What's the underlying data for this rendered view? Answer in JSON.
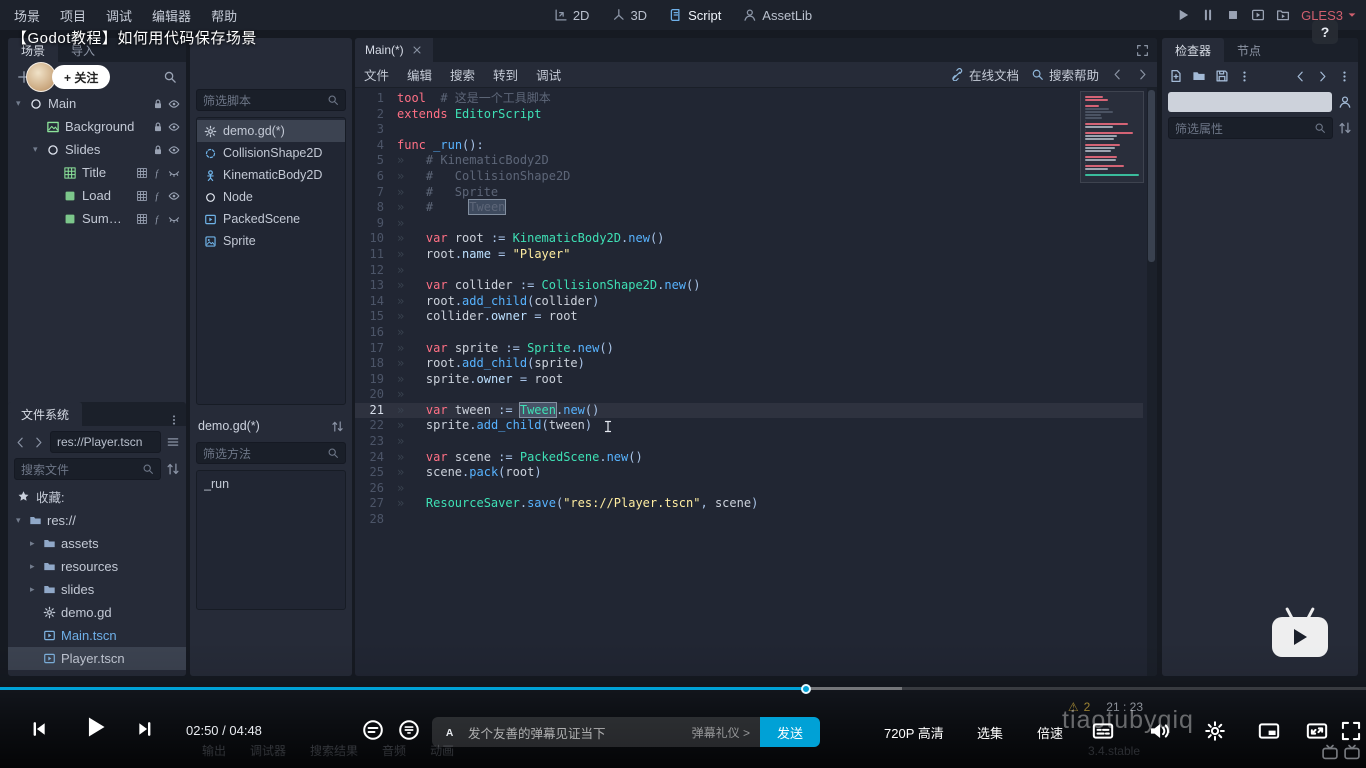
{
  "overlay": {
    "title": "【Godot教程】如何用代码保存场景",
    "follow": "+ 关注",
    "help": "?",
    "watermark": "tiaotubyqiq"
  },
  "menubar": {
    "items": [
      "场景",
      "项目",
      "调试",
      "编辑器",
      "帮助"
    ],
    "workspaces": [
      {
        "label": "2D",
        "icon": "ws2d"
      },
      {
        "label": "3D",
        "icon": "ws3d"
      },
      {
        "label": "Script",
        "icon": "wsscript",
        "active": true
      },
      {
        "label": "AssetLib",
        "icon": "person"
      }
    ],
    "playback": [
      "play",
      "pause",
      "stopsq",
      "playscene",
      "playcustom"
    ],
    "renderer": "GLES3"
  },
  "left_dock": {
    "tabs": [
      {
        "label": "场景",
        "active": true
      },
      {
        "label": "导入"
      }
    ],
    "scene_tree": [
      {
        "label": "Main",
        "depth": 0,
        "expand": true,
        "icon": "nodecirc",
        "color": "#dfe4ee",
        "buttons": [
          "lock",
          "eye"
        ]
      },
      {
        "label": "Background",
        "depth": 1,
        "icon": "texture",
        "color": "#8ce39a",
        "buttons": [
          "lock",
          "eye"
        ]
      },
      {
        "label": "Slides",
        "depth": 1,
        "expand": true,
        "icon": "nodecirc",
        "color": "#dfe4ee",
        "buttons": [
          "lock",
          "eye"
        ]
      },
      {
        "label": "Title",
        "depth": 2,
        "icon": "grid",
        "color": "#8ce39a",
        "buttons": [
          "grid",
          "fscript",
          "eyeclosed"
        ]
      },
      {
        "label": "Load",
        "depth": 2,
        "icon": "controlsq",
        "color": "#8ce39a",
        "buttons": [
          "grid",
          "fscript",
          "eye"
        ]
      },
      {
        "label": "Summary",
        "depth": 2,
        "icon": "controlsq",
        "color": "#8ce39a",
        "buttons": [
          "grid",
          "fscript",
          "eyeclosed"
        ]
      }
    ],
    "filesystem": {
      "title": "文件系统",
      "path": "res://Player.tscn",
      "search_placeholder": "搜索文件",
      "favorites_label": "收藏:",
      "tree": [
        {
          "label": "res://",
          "icon": "folder",
          "color": "#90a8c8",
          "twisty": "▾",
          "depth": 0
        },
        {
          "label": "assets",
          "icon": "folder",
          "color": "#90a8c8",
          "twisty": "▸",
          "depth": 1
        },
        {
          "label": "resources",
          "icon": "folder",
          "color": "#90a8c8",
          "twisty": "▸",
          "depth": 1
        },
        {
          "label": "slides",
          "icon": "folder",
          "color": "#90a8c8",
          "twisty": "▸",
          "depth": 1
        },
        {
          "label": "demo.gd",
          "icon": "gear",
          "color": "#c3cbd8",
          "depth": 1
        },
        {
          "label": "Main.tscn",
          "icon": "scenefilm",
          "color": "#7fb3e0",
          "depth": 1,
          "accent": true
        },
        {
          "label": "Player.tscn",
          "icon": "scenefilm",
          "color": "#7fb3e0",
          "depth": 1,
          "selected": true
        }
      ]
    }
  },
  "script_panel": {
    "filter_scripts_placeholder": "筛选脚本",
    "scripts": [
      {
        "label": "demo.gd(*)",
        "icon": "gear",
        "color": "#c3cbd8",
        "selected": true
      },
      {
        "label": "CollisionShape2D",
        "icon": "shape",
        "color": "#6fb3e8"
      },
      {
        "label": "KinematicBody2D",
        "icon": "body",
        "color": "#6fb3e8"
      },
      {
        "label": "Node",
        "icon": "nodecirc",
        "color": "#e2e7f0"
      },
      {
        "label": "PackedScene",
        "icon": "scenefilm",
        "color": "#6fb3e8"
      },
      {
        "label": "Sprite",
        "icon": "sprite",
        "color": "#6fb3e8"
      }
    ],
    "current_script": "demo.gd(*)",
    "filter_methods_placeholder": "筛选方法",
    "methods": [
      "_run"
    ]
  },
  "editor": {
    "scene_tab": "Main(*)",
    "menus": [
      "文件",
      "编辑",
      "搜索",
      "转到",
      "调试"
    ],
    "online_docs": "在线文档",
    "search_help": "搜索帮助",
    "warning_count": "2",
    "cursor_pos": "21 : 23",
    "current_line": 21,
    "lines": [
      [
        [
          "k",
          "tool"
        ],
        [
          "tx",
          "  "
        ],
        [
          "com",
          "# 这是一个工具脚本"
        ]
      ],
      [
        [
          "k",
          "extends"
        ],
        [
          "tx",
          " "
        ],
        [
          "ty",
          "EditorScript"
        ]
      ],
      [],
      [
        [
          "k",
          "func"
        ],
        [
          "tx",
          " "
        ],
        [
          "fn",
          "_run"
        ],
        [
          "sym",
          "():"
        ]
      ],
      [
        [
          "ws",
          "»   "
        ],
        [
          "com",
          "# KinematicBody2D"
        ]
      ],
      [
        [
          "ws",
          "»   "
        ],
        [
          "com",
          "#   CollisionShape2D"
        ]
      ],
      [
        [
          "ws",
          "»   "
        ],
        [
          "com",
          "#   Sprite"
        ]
      ],
      [
        [
          "ws",
          "»   "
        ],
        [
          "com",
          "#     "
        ],
        [
          "hlcom",
          "Tween"
        ]
      ],
      [
        [
          "ws",
          "»"
        ]
      ],
      [
        [
          "ws",
          "»   "
        ],
        [
          "k",
          "var"
        ],
        [
          "tx",
          " root "
        ],
        [
          "sym",
          ":= "
        ],
        [
          "ty",
          "KinematicBody2D"
        ],
        [
          "sym",
          "."
        ],
        [
          "fn",
          "new"
        ],
        [
          "sym",
          "()"
        ]
      ],
      [
        [
          "ws",
          "»   "
        ],
        [
          "tx",
          "root"
        ],
        [
          "sym",
          "."
        ],
        [
          "mem",
          "name"
        ],
        [
          "sym",
          " = "
        ],
        [
          "str",
          "\"Player\""
        ]
      ],
      [
        [
          "ws",
          "»"
        ]
      ],
      [
        [
          "ws",
          "»   "
        ],
        [
          "k",
          "var"
        ],
        [
          "tx",
          " collider "
        ],
        [
          "sym",
          ":= "
        ],
        [
          "ty",
          "CollisionShape2D"
        ],
        [
          "sym",
          "."
        ],
        [
          "fn",
          "new"
        ],
        [
          "sym",
          "()"
        ]
      ],
      [
        [
          "ws",
          "»   "
        ],
        [
          "tx",
          "root"
        ],
        [
          "sym",
          "."
        ],
        [
          "fn",
          "add_child"
        ],
        [
          "sym",
          "("
        ],
        [
          "tx",
          "collider"
        ],
        [
          "sym",
          ")"
        ]
      ],
      [
        [
          "ws",
          "»   "
        ],
        [
          "tx",
          "collider"
        ],
        [
          "sym",
          "."
        ],
        [
          "mem",
          "owner"
        ],
        [
          "sym",
          " = "
        ],
        [
          "tx",
          "root"
        ]
      ],
      [
        [
          "ws",
          "»"
        ]
      ],
      [
        [
          "ws",
          "»   "
        ],
        [
          "k",
          "var"
        ],
        [
          "tx",
          " sprite "
        ],
        [
          "sym",
          ":= "
        ],
        [
          "ty",
          "Sprite"
        ],
        [
          "sym",
          "."
        ],
        [
          "fn",
          "new"
        ],
        [
          "sym",
          "()"
        ]
      ],
      [
        [
          "ws",
          "»   "
        ],
        [
          "tx",
          "root"
        ],
        [
          "sym",
          "."
        ],
        [
          "fn",
          "add_child"
        ],
        [
          "sym",
          "("
        ],
        [
          "tx",
          "sprite"
        ],
        [
          "sym",
          ")"
        ]
      ],
      [
        [
          "ws",
          "»   "
        ],
        [
          "tx",
          "sprite"
        ],
        [
          "sym",
          "."
        ],
        [
          "mem",
          "owner"
        ],
        [
          "sym",
          " = "
        ],
        [
          "tx",
          "root"
        ]
      ],
      [
        [
          "ws",
          "»"
        ]
      ],
      [
        [
          "ws",
          "»   "
        ],
        [
          "k",
          "var"
        ],
        [
          "tx",
          " tween "
        ],
        [
          "sym",
          ":= "
        ],
        [
          "hlty",
          "Tween"
        ],
        [
          "sym",
          "."
        ],
        [
          "fn",
          "new"
        ],
        [
          "sym",
          "()"
        ]
      ],
      [
        [
          "ws",
          "»   "
        ],
        [
          "tx",
          "sprite"
        ],
        [
          "sym",
          "."
        ],
        [
          "fn",
          "add_child"
        ],
        [
          "sym",
          "("
        ],
        [
          "tx",
          "tween"
        ],
        [
          "sym",
          ")"
        ]
      ],
      [
        [
          "ws",
          "»"
        ]
      ],
      [
        [
          "ws",
          "»   "
        ],
        [
          "k",
          "var"
        ],
        [
          "tx",
          " scene "
        ],
        [
          "sym",
          ":= "
        ],
        [
          "ty",
          "PackedScene"
        ],
        [
          "sym",
          "."
        ],
        [
          "fn",
          "new"
        ],
        [
          "sym",
          "()"
        ]
      ],
      [
        [
          "ws",
          "»   "
        ],
        [
          "tx",
          "scene"
        ],
        [
          "sym",
          "."
        ],
        [
          "fn",
          "pack"
        ],
        [
          "sym",
          "("
        ],
        [
          "tx",
          "root"
        ],
        [
          "sym",
          ")"
        ]
      ],
      [
        [
          "ws",
          "»"
        ]
      ],
      [
        [
          "ws",
          "»   "
        ],
        [
          "ty",
          "ResourceSaver"
        ],
        [
          "sym",
          "."
        ],
        [
          "fn",
          "save"
        ],
        [
          "sym",
          "("
        ],
        [
          "str",
          "\"res://Player.tscn\""
        ],
        [
          "sym",
          ", "
        ],
        [
          "tx",
          "scene"
        ],
        [
          "sym",
          ")"
        ]
      ],
      []
    ]
  },
  "inspector": {
    "tabs": [
      {
        "label": "检查器",
        "active": true
      },
      {
        "label": "节点"
      }
    ],
    "filter_placeholder": "筛选属性"
  },
  "bottom": {
    "panels": [
      "输出",
      "调试器",
      "搜索结果",
      "音频",
      "动画"
    ],
    "version": "3.4.stable"
  },
  "player": {
    "time": "02:50 / 04:48",
    "progress_pct": 59,
    "buffer_pct": 66,
    "accent": "#00a1d6",
    "danmaku_placeholder": "发个友善的弹幕见证当下",
    "etiquette": "弹幕礼仪 >",
    "send": "发送",
    "quality": "720P 高清",
    "episodes": "选集",
    "speed": "倍速"
  }
}
